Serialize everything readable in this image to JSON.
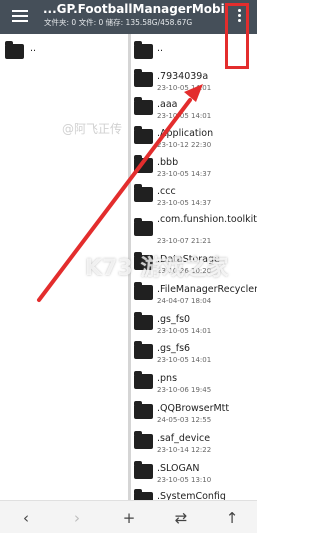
{
  "appbar": {
    "title": "...GP.FootballManagerMobile/",
    "subtitle": "文件夹: 0  文件: 0  储存: 135.58G/458.67G"
  },
  "left_pane": {
    "items": [
      {
        "name": ".."
      }
    ]
  },
  "right_pane": {
    "items": [
      {
        "name": "..",
        "date": ""
      },
      {
        "name": ".7934039a",
        "date": "23-10-05 14:01"
      },
      {
        "name": ".aaa",
        "date": "23-10-05 14:01"
      },
      {
        "name": ".Application",
        "date": "23-10-12 22:30"
      },
      {
        "name": ".bbb",
        "date": "23-10-05 14:37"
      },
      {
        "name": ".ccc",
        "date": "23-10-05 14:37"
      },
      {
        "name": ".com.funshion.toolkits.ad",
        "date": "23-10-07 21:21"
      },
      {
        "name": ".DataStorage",
        "date": "23-10-26 10:20"
      },
      {
        "name": ".FileManagerRecycler",
        "date": "24-04-07 18:04"
      },
      {
        "name": ".gs_fs0",
        "date": "23-10-05 14:01"
      },
      {
        "name": ".gs_fs6",
        "date": "23-10-05 14:01"
      },
      {
        "name": ".pns",
        "date": "23-10-06 19:45"
      },
      {
        "name": ".QQBrowserMtt",
        "date": "24-05-03 12:55"
      },
      {
        "name": ".saf_device",
        "date": "23-10-14 12:22"
      },
      {
        "name": ".SLOGAN",
        "date": "23-10-05 13:10"
      },
      {
        "name": ".SystemConfig",
        "date": ""
      }
    ]
  },
  "toolbar": {
    "back_icon": "‹",
    "forward_icon": "›",
    "add_icon": "+",
    "swap_icon": "⇄",
    "up_icon": "↑"
  },
  "watermarks": {
    "text1": "@阿飞正传",
    "text2": "K73 游戏之家"
  },
  "colors": {
    "appbar": "#454f59",
    "highlight": "#e32d2d",
    "arrow": "#e32d2d"
  }
}
